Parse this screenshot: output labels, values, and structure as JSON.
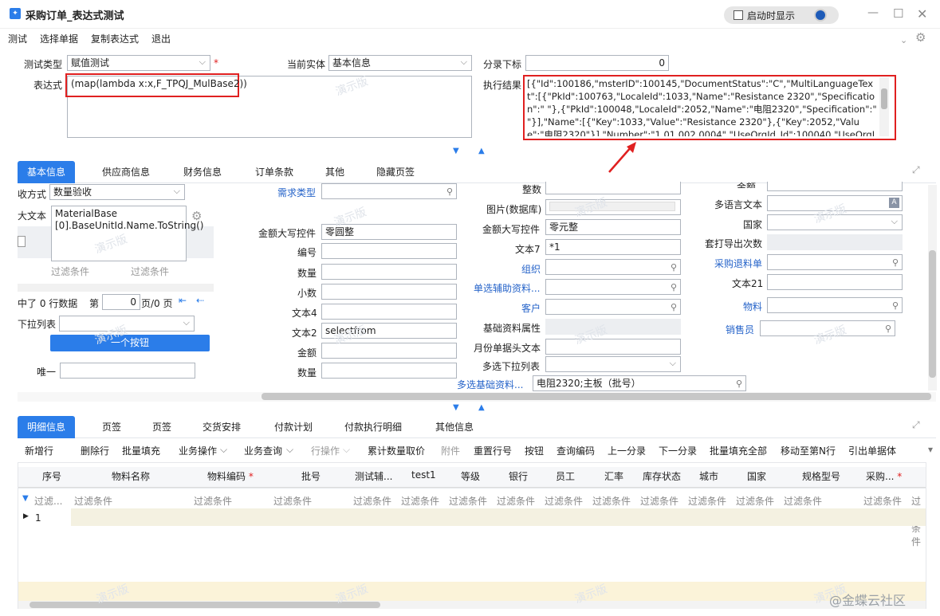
{
  "window": {
    "title": "采购订单_表达式测试",
    "startup_label": "启动时显示"
  },
  "menu": [
    "测试",
    "选择单据",
    "复制表达式",
    "退出"
  ],
  "top": {
    "test_type_label": "测试类型",
    "test_type_value": "赋值测试",
    "entity_label": "当前实体",
    "entity_value": "基本信息",
    "entry_label": "分录下标",
    "entry_value": "0",
    "expr_label": "表达式",
    "expr_value": "(map(lambda x:x,F_TPQJ_MulBase2))",
    "result_label": "执行结果",
    "result_value": "[{\"Id\":100186,\"msterID\":100145,\"DocumentStatus\":\"C\",\"MultiLanguageText\":[{\"PkId\":100763,\"LocaleId\":1033,\"Name\":\"Resistance 2320\",\"Specification\":\" \"},{\"PkId\":100048,\"LocaleId\":2052,\"Name\":\"电阻2320\",\"Specification\":\" \"}],\"Name\":[{\"Key\":1033,\"Value\":\"Resistance 2320\"},{\"Key\":2052,\"Value\":\"电阻2320\"}],\"Number\":\"1.01.002.0004\",\"UseOrgId_Id\":100040,\"UseOrgId\":"
  },
  "tabs1": [
    "基本信息",
    "供应商信息",
    "财务信息",
    "订单条款",
    "其他",
    "隐藏页签"
  ],
  "form": {
    "c1": {
      "recv_label": "收方式",
      "recv_value": "数量验收",
      "bigtext_label": "大文本",
      "tooltip": "MaterialBase\n[0].BaseUnitId.Name.ToString()",
      "filter1": "过滤条件",
      "filter2": "过滤条件",
      "rows_text": "中了 0 行数据",
      "page_label": "第",
      "page_value": "0",
      "page_suffix": "页/0 页",
      "dropdown_label": "下拉列表",
      "button_label": "一个按钮",
      "unique_label": "唯一"
    },
    "c2": {
      "demand_label": "需求类型",
      "amount_upper_label": "金额大写控件",
      "amount_upper_value": "零圆整",
      "code_label": "编号",
      "qty_label": "数量",
      "decimal_label": "小数",
      "text4_label": "文本4",
      "text2_label": "文本2",
      "text2_value": "selectfrom",
      "amount_label": "金额",
      "qty2_label": "数量"
    },
    "c3": {
      "integer_label": "整数",
      "image_label": "图片(数据库)",
      "amount_upper_label": "金额大写控件",
      "amount_upper_value": "零元整",
      "text7_label": "文本7",
      "text7_value": "*1",
      "org_label": "组织",
      "single_aux_label": "单选辅助资料...",
      "customer_label": "客户",
      "base_attr_label": "基础资料属性",
      "month_label": "月份单据头文本",
      "multi_dropdown_label": "多选下拉列表",
      "multi_base_label": "多选基础资料...",
      "multi_base_value": "电阻2320;主板（批号）"
    },
    "c4": {
      "amount_label": "金额",
      "multilang_label": "多语言文本",
      "country_label": "国家",
      "print_label": "套打导出次数",
      "return_label": "采购退料单",
      "text21_label": "文本21",
      "material_label": "物料",
      "salesman_label": "销售员"
    }
  },
  "tabs2": [
    "明细信息",
    "页签",
    "页签",
    "交货安排",
    "付款计划",
    "付款执行明细",
    "其他信息"
  ],
  "toolbar": [
    "新增行",
    "删除行",
    "批量填充",
    "业务操作",
    "业务查询",
    "行操作",
    "累计数量取价",
    "附件",
    "重置行号",
    "按钮",
    "查询编码",
    "上一分录",
    "下一分录",
    "批量填充全部",
    "移动至第N行",
    "引出单据体"
  ],
  "grid": {
    "headers": [
      "序号",
      "物料名称",
      "物料编码",
      "批号",
      "测试辅...",
      "test1",
      "等级",
      "银行",
      "员工",
      "汇率",
      "库存状态",
      "城市",
      "国家",
      "规格型号",
      "采购..."
    ],
    "filter": "过滤条件",
    "filter_short": "过滤...",
    "row1": "1"
  },
  "watermark": "演示版",
  "corner": "@金蝶云社区",
  "colors": {
    "accent": "#2b7de9",
    "highlight": "#e02020",
    "row_yellow": "#fbf3d9"
  }
}
